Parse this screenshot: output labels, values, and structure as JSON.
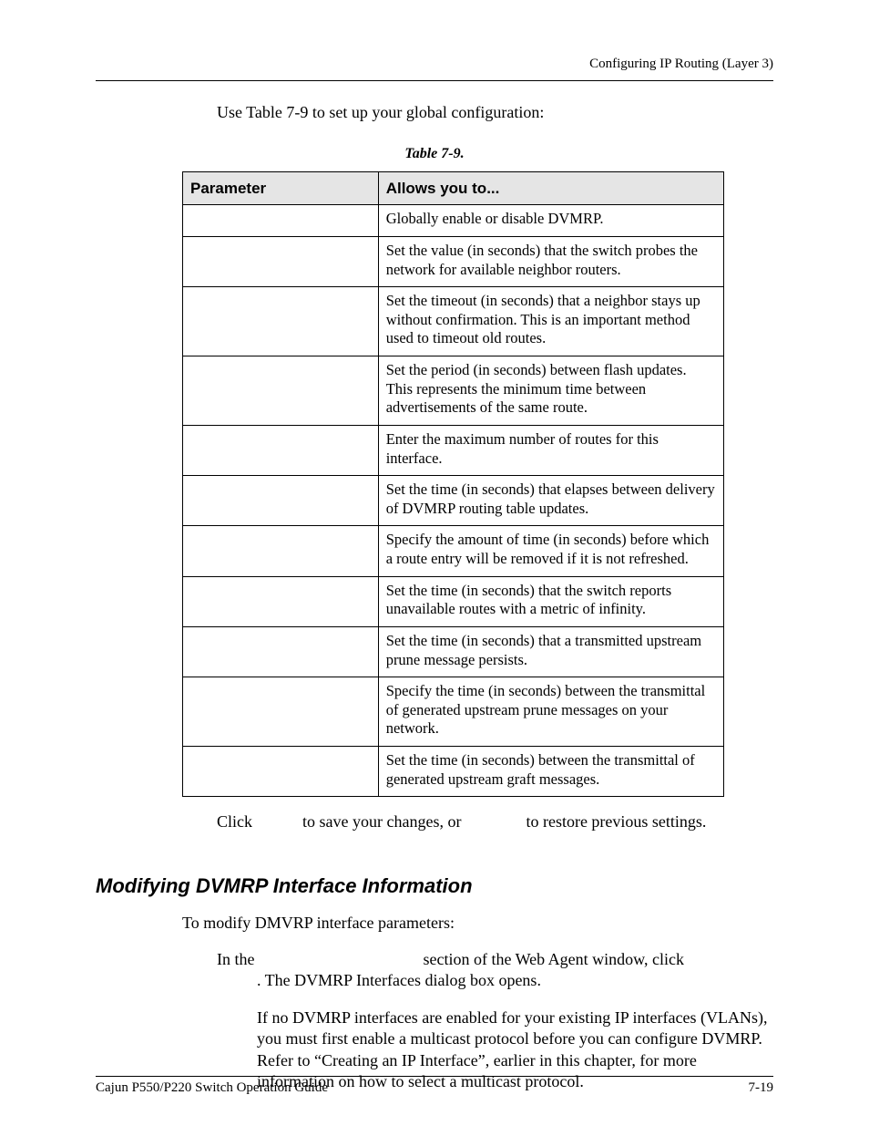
{
  "header": {
    "running": "Configuring IP Routing (Layer 3)"
  },
  "intro": "Use Table 7-9 to set up your global configuration:",
  "table": {
    "caption": "Table 7-9.",
    "columns": {
      "param": "Parameter",
      "desc": "Allows you to..."
    },
    "rows": [
      {
        "param": "",
        "desc": "Globally enable or disable DVMRP."
      },
      {
        "param": "",
        "desc": "Set the value (in seconds) that the switch probes the network for available neighbor routers."
      },
      {
        "param": "",
        "desc": "Set the timeout (in seconds) that a neighbor stays up without confirmation. This is an important method used to timeout old routes."
      },
      {
        "param": "",
        "desc": "Set the period (in seconds) between flash updates. This represents the minimum time between advertisements of the same route."
      },
      {
        "param": "",
        "desc": "Enter the maximum number of routes for this interface."
      },
      {
        "param": "",
        "desc": "Set the time (in seconds) that elapses between delivery of DVMRP routing table updates."
      },
      {
        "param": "",
        "desc": "Specify the amount of time (in seconds) before which a route entry will be removed if it is not refreshed."
      },
      {
        "param": "",
        "desc": "Set the time (in seconds) that the switch reports unavailable routes with a metric of infinity."
      },
      {
        "param": "",
        "desc": "Set the time (in seconds) that a transmitted upstream prune message persists."
      },
      {
        "param": "",
        "desc": "Specify the time (in seconds) between the transmittal of generated upstream prune messages on your network."
      },
      {
        "param": "",
        "desc": "Set the time (in seconds) between the transmittal of generated upstream graft messages."
      }
    ]
  },
  "step3": {
    "a": "Click ",
    "b": " to save your changes, or ",
    "c": " to restore previous settings."
  },
  "h2": "Modifying DVMRP Interface Information",
  "mod_intro": "To modify DMVRP interface parameters:",
  "step1": {
    "line1a": "In the ",
    "line1b": " section of the Web Agent window, click",
    "line2": ". The DVMRP Interfaces dialog box opens."
  },
  "note": "If no DVMRP interfaces are enabled for your existing IP interfaces (VLANs), you must first enable a multicast protocol before you can configure DVMRP. Refer to “Creating an IP Interface”, earlier in this chapter, for more information on how to select a multicast protocol.",
  "footer": {
    "left": "Cajun P550/P220 Switch Operation Guide",
    "right": "7-19"
  }
}
